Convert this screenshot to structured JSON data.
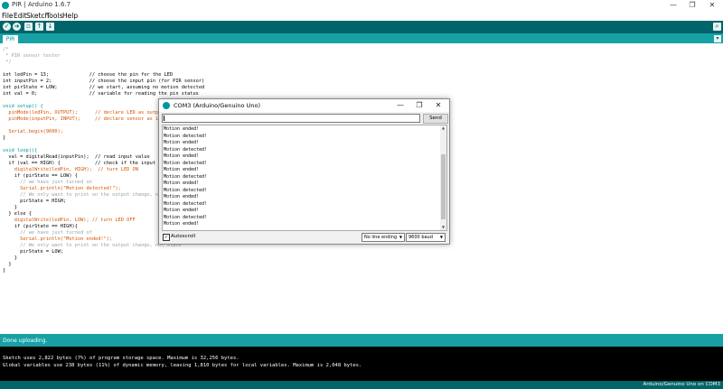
{
  "window": {
    "title": "PIR | Arduino 1.6.7",
    "minimize": "—",
    "maximize": "❐",
    "close": "✕"
  },
  "menu": [
    "File",
    "Edit",
    "Sketch",
    "Tools",
    "Help"
  ],
  "toolbar": {
    "verify": "✓",
    "upload": "➜",
    "new": "▫",
    "open": "↑",
    "save": "↓",
    "serial": "⌕"
  },
  "tab": {
    "label": "PIR",
    "menu": "▾"
  },
  "code": [
    "/*",
    " * PIR sensor tester",
    " */",
    "",
    "int ledPin = 13;              // choose the pin for the LED",
    "int inputPin = 2;             // choose the input pin (for PIR sensor)",
    "int pirState = LOW;           // we start, assuming no motion detected",
    "int val = 0;                  // variable for reading the pin status",
    "",
    "void setup() {",
    "  pinMode(ledPin, OUTPUT);      // declare LED as output",
    "  pinMode(inputPin, INPUT);     // declare sensor as input",
    "",
    "  Serial.begin(9600);",
    "}",
    "",
    "void loop(){",
    "  val = digitalRead(inputPin);  // read input value",
    "  if (val == HIGH) {            // check if the input is HIGH",
    "    digitalWrite(ledPin, HIGH);  // turn LED ON",
    "    if (pirState == LOW) {",
    "      // we have just turned on",
    "      Serial.println(\"Motion detected!\");",
    "      // We only want to print on the output change, not state",
    "      pirState = HIGH;",
    "    }",
    "  } else {",
    "    digitalWrite(ledPin, LOW); // turn LED OFF",
    "    if (pirState == HIGH){",
    "      // we have just turned of",
    "      Serial.println(\"Motion ended!\");",
    "      // We only want to print on the output change, not state",
    "      pirState = LOW;",
    "    }",
    "  }",
    "}"
  ],
  "status": {
    "message": "Done uploading."
  },
  "console": [
    "Sketch uses 2,822 bytes (7%) of program storage space. Maximum is 32,256 bytes.",
    "Global variables use 238 bytes (11%) of dynamic memory, leaving 1,810 bytes for local variables. Maximum is 2,048 bytes."
  ],
  "footer": {
    "board": "Arduino/Genuino Uno on COM3"
  },
  "serial_monitor": {
    "title": "COM3 (Arduino/Genuino Uno)",
    "input_value": "",
    "send_label": "Send",
    "output": [
      "Motion ended!",
      "Motion detected!",
      "Motion ended!",
      "Motion detected!",
      "Motion ended!",
      "Motion detected!",
      "Motion ended!",
      "Motion detected!",
      "Motion ended!",
      "Motion detected!",
      "Motion ended!",
      "Motion detected!",
      "Motion ended!",
      "Motion detected!",
      "Motion ended!"
    ],
    "autoscroll_label": "Autoscroll",
    "autoscroll_checked": "✓",
    "line_ending": "No line ending",
    "baud": "9600 baud"
  },
  "colors": {
    "teal_dark": "#006468",
    "teal": "#00979c",
    "teal_light": "#17a1a5"
  }
}
